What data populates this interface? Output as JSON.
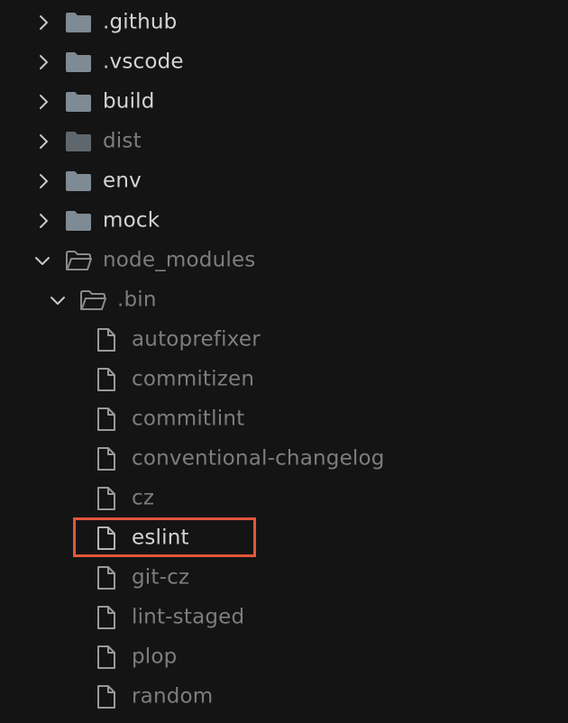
{
  "explorer": {
    "folders": [
      {
        "name": ".github",
        "expanded": false
      },
      {
        "name": ".vscode",
        "expanded": false
      },
      {
        "name": "build",
        "expanded": false
      },
      {
        "name": "dist",
        "expanded": false,
        "dimmed": true
      },
      {
        "name": "env",
        "expanded": false
      },
      {
        "name": "mock",
        "expanded": false
      },
      {
        "name": "node_modules",
        "expanded": true,
        "dimmed": true
      }
    ],
    "bin_folder": {
      "name": ".bin",
      "expanded": true,
      "dimmed": true
    },
    "bin_files": [
      {
        "name": "autoprefixer"
      },
      {
        "name": "commitizen"
      },
      {
        "name": "commitlint"
      },
      {
        "name": "conventional-changelog"
      },
      {
        "name": "cz"
      },
      {
        "name": "eslint",
        "highlighted": true
      },
      {
        "name": "git-cz"
      },
      {
        "name": "lint-staged"
      },
      {
        "name": "plop"
      },
      {
        "name": "random"
      }
    ]
  },
  "colors": {
    "background": "#141414",
    "text_bright": "#d4d4d4",
    "text_dim": "#7d7d7d",
    "folder_icon": "#7e8a94",
    "highlight_border": "#e2573b"
  },
  "icons": {
    "chevron_collapsed": "chevron-right-icon",
    "chevron_expanded": "chevron-down-icon",
    "folder_closed": "folder-icon",
    "folder_open": "folder-open-icon",
    "file": "file-icon"
  }
}
